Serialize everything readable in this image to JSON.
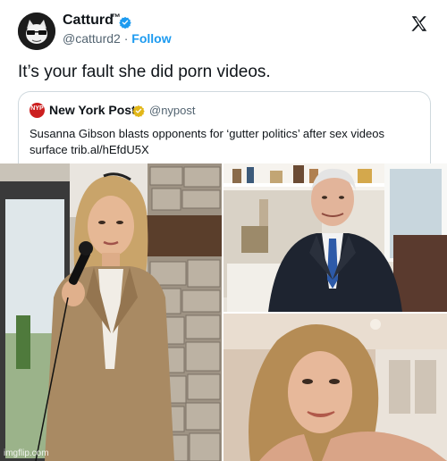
{
  "tweet": {
    "author": {
      "name": "Catturd",
      "trademark": "™",
      "handle": "@catturd2",
      "separator": " · ",
      "follow_label": "Follow",
      "verified": true
    },
    "platform_icon": "x-logo-icon",
    "text": "It’s your fault she did porn videos."
  },
  "quoted_tweet": {
    "author": {
      "name": "New York Post",
      "handle": "@nypost",
      "logo_text": "NEW YORK POST",
      "verified": true
    },
    "text": "Susanna Gibson blasts opponents for ‘gutter politics’ after sex videos surface trib.al/hEfdU5X"
  },
  "photos": [
    {
      "id": "photo-speaker",
      "description_icon": "woman-with-microphone-photo"
    },
    {
      "id": "photo-man-suit",
      "description_icon": "man-in-suit-photo"
    },
    {
      "id": "photo-woman-selfie",
      "description_icon": "woman-webcam-photo"
    }
  ],
  "watermark": "imgflip.com",
  "colors": {
    "verified_blue": "#1d9bf0",
    "verified_gold": "#e2b719",
    "follow_blue": "#1d9bf0",
    "nyp_red": "#cc1f1f",
    "muted_text": "#536471"
  }
}
